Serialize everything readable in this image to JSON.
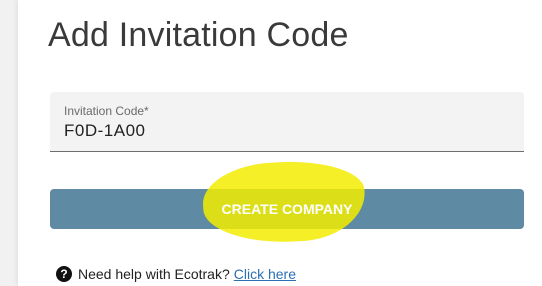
{
  "page": {
    "title": "Add Invitation Code"
  },
  "invitation_field": {
    "label": "Invitation Code*",
    "value": "F0D-1A00"
  },
  "create_button": {
    "label": "CREATE COMPANY"
  },
  "help": {
    "icon": "question-circle-icon",
    "text": "Need help with Ecotrak?",
    "link_text": "Click here"
  },
  "colors": {
    "button_bg": "#5f8aa3",
    "highlight": "#f2ec00",
    "link": "#2c6fb3"
  }
}
